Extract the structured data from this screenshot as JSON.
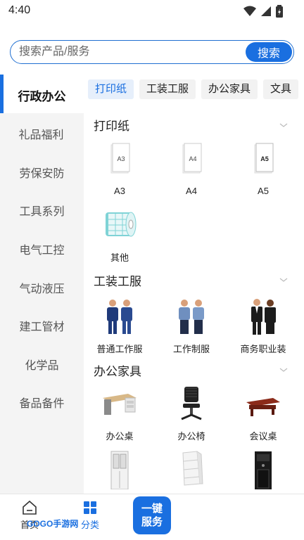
{
  "status_bar": {
    "time": "4:40"
  },
  "search": {
    "placeholder": "搜索产品/服务",
    "button_label": "搜索"
  },
  "sidebar": {
    "items": [
      {
        "label": "行政办公",
        "active": true
      },
      {
        "label": "礼品福利"
      },
      {
        "label": "劳保安防"
      },
      {
        "label": "工具系列"
      },
      {
        "label": "电气工控"
      },
      {
        "label": "气动液压"
      },
      {
        "label": "建工管材"
      },
      {
        "label": "化学品"
      },
      {
        "label": "备品备件"
      }
    ]
  },
  "tabs": [
    {
      "label": "打印纸",
      "active": true
    },
    {
      "label": "工装工服"
    },
    {
      "label": "办公家具"
    },
    {
      "label": "文具"
    }
  ],
  "sections": [
    {
      "title": "打印纸",
      "products": [
        {
          "label": "A3",
          "paper_text": "A3"
        },
        {
          "label": "A4",
          "paper_text": "A4"
        },
        {
          "label": "A5",
          "paper_text": "A5"
        },
        {
          "label": "其他"
        }
      ]
    },
    {
      "title": "工装工服",
      "products": [
        {
          "label": "普通工作服"
        },
        {
          "label": "工作制服"
        },
        {
          "label": "商务职业装"
        }
      ]
    },
    {
      "title": "办公家具",
      "products": [
        {
          "label": "办公桌"
        },
        {
          "label": "办公椅"
        },
        {
          "label": "会议桌"
        },
        {
          "label": ""
        },
        {
          "label": ""
        },
        {
          "label": ""
        }
      ]
    }
  ],
  "bottom_nav": {
    "home_label": "首页",
    "category_label": "分类",
    "service_label_line1": "一键",
    "service_label_line2": "服务",
    "watermark": "GOGO手游网"
  },
  "colors": {
    "accent": "#1a6fe0"
  }
}
